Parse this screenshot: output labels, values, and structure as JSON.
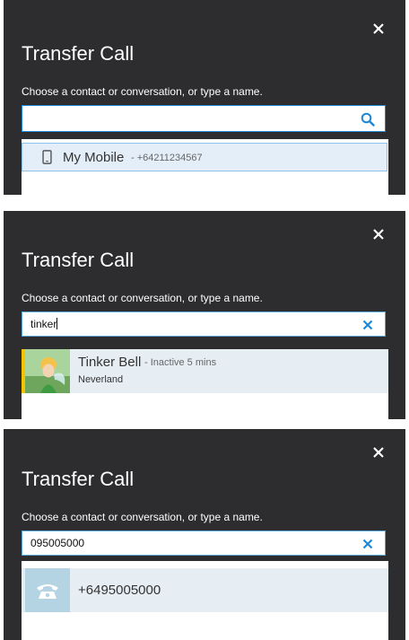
{
  "colors": {
    "panel_bg": "#2d2d30",
    "accent": "#1e88d4",
    "result_bg": "#e6eef4",
    "presence_yellow": "#f6c400"
  },
  "dialogs": [
    {
      "title": "Transfer Call",
      "instruction": "Choose a contact or conversation, or type a name.",
      "search": {
        "value": "",
        "action_icon": "search-icon"
      },
      "result": {
        "icon": "mobile-phone-icon",
        "name": "My Mobile",
        "detail": "- +64211234567"
      }
    },
    {
      "title": "Transfer Call",
      "instruction": "Choose a contact or conversation, or type a name.",
      "search": {
        "value": "tinker",
        "action_icon": "clear-icon"
      },
      "result": {
        "icon": "avatar",
        "name": "Tinker Bell",
        "status": "- Inactive 5 mins",
        "location": "Neverland"
      }
    },
    {
      "title": "Transfer Call",
      "instruction": "Choose a contact or conversation, or type a name.",
      "search": {
        "value": "095005000",
        "action_icon": "clear-icon"
      },
      "result": {
        "icon": "phone-icon",
        "number": "+6495005000"
      }
    }
  ]
}
